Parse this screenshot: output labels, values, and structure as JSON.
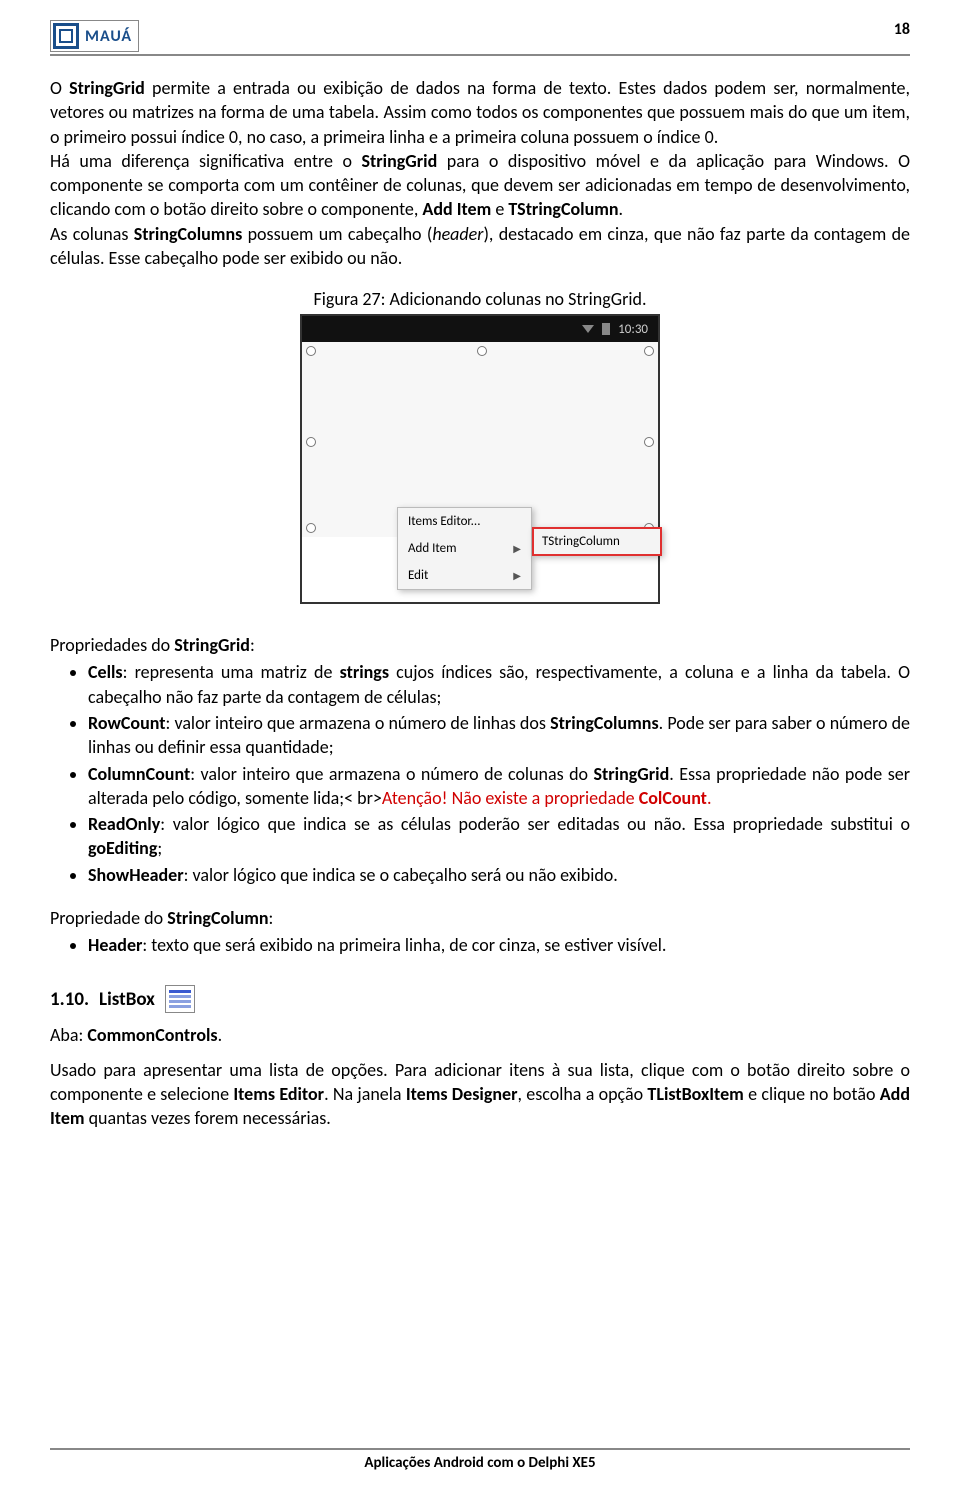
{
  "header": {
    "logo_text": "MAUÁ",
    "page_number": "18"
  },
  "intro": {
    "p1a": "O ",
    "p1b": "StringGrid",
    "p1c": " permite a entrada ou exibição de dados na forma de texto. Estes dados podem ser, normalmente, vetores ou matrizes na forma de uma tabela. Assim como todos os componentes que possuem mais do que um item, o primeiro possui índice 0, no caso, a primeira linha e a primeira coluna possuem o índice 0.",
    "p2a": "Há uma diferença significativa entre o ",
    "p2b": "StringGrid",
    "p2c": " para o dispositivo móvel e da aplicação para Windows. O componente se comporta com um contêiner de colunas, que devem ser adicionadas em tempo de desenvolvimento, clicando com o botão direito sobre o componente, ",
    "p2d": "Add Item",
    "p2e": " e ",
    "p2f": "TStringColumn",
    "p2g": ".",
    "p3a": "As colunas ",
    "p3b": "StringColumns",
    "p3c": " possuem um cabeçalho (",
    "p3d": "header",
    "p3e": "), destacado em cinza, que não faz parte da contagem de células. Esse cabeçalho pode ser exibido ou não."
  },
  "figure": {
    "caption": "Figura 27: Adicionando colunas no StringGrid.",
    "status_time": "10:30",
    "menu": {
      "items_editor": "Items Editor...",
      "add_item": "Add Item",
      "edit": "Edit",
      "submenu": "TStringColumn"
    }
  },
  "props_stringgrid": {
    "title_a": "Propriedades do ",
    "title_b": "StringGrid",
    "title_c": ":",
    "cells_a": "Cells",
    "cells_b": ": representa uma matriz de ",
    "cells_c": "strings",
    "cells_d": " cujos índices são, respectivamente, a coluna e a linha da tabela. O cabeçalho não faz parte da contagem de células;",
    "rowcount_a": "RowCount",
    "rowcount_b": ": valor inteiro que armazena o número de linhas dos ",
    "rowcount_c": "StringColumns",
    "rowcount_d": ". Pode ser para saber o número de linhas ou definir essa quantidade;",
    "colcount_a": "ColumnCount",
    "colcount_b": ": valor inteiro que armazena o número de colunas do ",
    "colcount_c": "StringGrid",
    "colcount_d": ". Essa propriedade não pode ser alterada pelo código, somente lida;",
    "warn_a": "Atenção! Não existe a propriedade ",
    "warn_b": "ColCount",
    "warn_c": ".",
    "readonly_a": "ReadOnly",
    "readonly_b": ": valor lógico que indica se as células poderão ser editadas ou não. Essa propriedade substitui o ",
    "readonly_c": "goEditing",
    "readonly_d": ";",
    "showheader_a": "ShowHeader",
    "showheader_b": ": valor lógico que indica se o cabeçalho será ou não exibido."
  },
  "props_stringcolumn": {
    "title_a": "Propriedade do ",
    "title_b": "StringColumn",
    "title_c": ":",
    "header_a": "Header",
    "header_b": ": texto que será exibido na primeira linha, de cor cinza, se estiver visível."
  },
  "section": {
    "num": "1.10.",
    "title": "ListBox"
  },
  "listbox": {
    "aba_a": "Aba: ",
    "aba_b": "CommonControls",
    "aba_c": ".",
    "desc_a": "Usado para apresentar uma lista de opções. Para adicionar itens à sua lista, clique com o botão direito sobre o componente e selecione ",
    "desc_b": "Items Editor",
    "desc_c": ". Na janela ",
    "desc_d": "Items Designer",
    "desc_e": ", escolha a opção ",
    "desc_f": "TListBoxItem",
    "desc_g": " e clique no botão ",
    "desc_h": "Add Item",
    "desc_i": " quantas vezes forem necessárias."
  },
  "footer": {
    "text": "Aplicações Android com o Delphi XE5"
  }
}
